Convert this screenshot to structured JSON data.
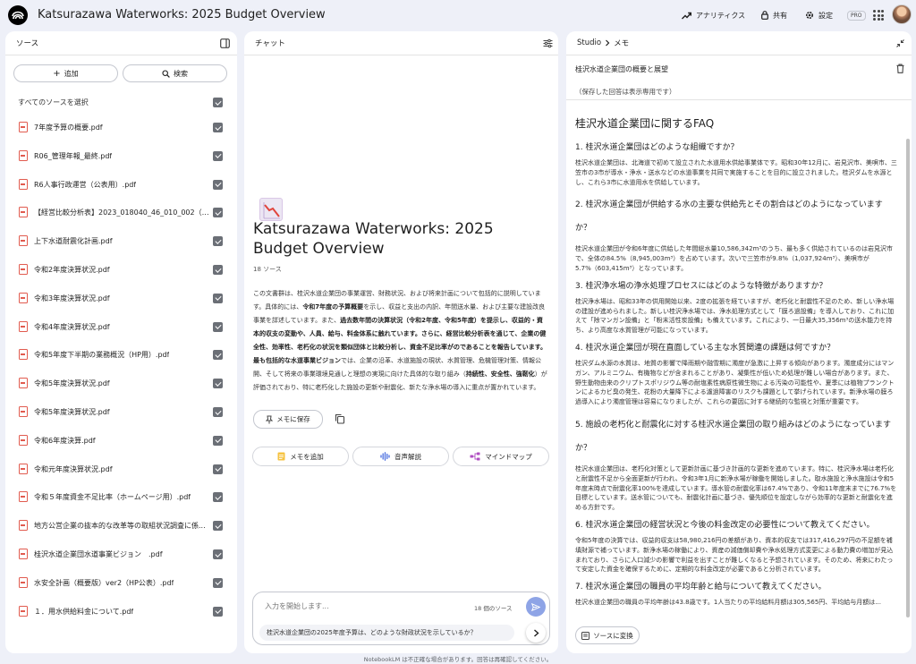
{
  "app": {
    "title": "Katsurazawa Waterworks: 2025 Budget Overview",
    "analytics_label": "アナリティクス",
    "share_label": "共有",
    "settings_label": "設定",
    "pro_badge": "PRO"
  },
  "sources": {
    "header": "ソース",
    "add_label": "追加",
    "search_label": "検索",
    "select_all_label": "すべてのソースを選択",
    "items": [
      "7年度予算の概要.pdf",
      "R06_管理年報_最終.pdf",
      "R6人事行政運営（公表用）.pdf",
      "【経営比較分析表】2023_018040_46_010_002（桂...",
      "上下水道耐震化計画.pdf",
      "令和2年度決算状況.pdf",
      "令和3年度決算状況.pdf",
      "令和4年度決算状況.pdf",
      "令和5年度下半期の業務概況（HP用）.pdf",
      "令和5年度決算状況.pdf",
      "令和5年度決算状況.pdf",
      "令和6年度決算.pdf",
      "令和元年度決算状況.pdf",
      "令和５年度資金不足比率（ホームページ用）.pdf",
      "地方公営企業の抜本的な改革等の取組状況調査に係...",
      "桂沢水道企業団水道事業ビジョン　.pdf",
      "水安全計画（概要版）ver2（HP公表）.pdf",
      "１．用水供給料金について.pdf"
    ]
  },
  "chat": {
    "header": "チャット",
    "notebook_title": "Katsurazawa Waterworks: 2025 Budget Overview",
    "source_count": "18 ソース",
    "summary_parts": [
      {
        "t": "この文書群は、桂沢水道企業団の事業運営、財務状況、および将来計画について包括的に説明しています。具体的には、",
        "b": false
      },
      {
        "t": "令和7年度の予算概要",
        "b": true
      },
      {
        "t": "を示し、収益と支出の内訳、年間送水量、および主要な建設改良事業を詳述しています。また、",
        "b": false
      },
      {
        "t": "過去数年間の決算状況（令和2年度、令和5年度）を提示し、収益的・資本的収支の変動や、人員、給与、料金体系に触れています。さらに、経営比較分析表を通じて、企業の健全性、効率性、老朽化の状況を類似団体と比較分析し、資金不足比率がのであることを報告しています。最も包括的な水道事業ビジョン",
        "b": true
      },
      {
        "t": "では、企業の沿革、水道施設の現状、水質管理、危機管理対策、情報公開、そして将来の事業環境見通しと理想の実現に向けた具体的な取り組み（",
        "b": false
      },
      {
        "t": "持続性、安全性、強靭化",
        "b": true
      },
      {
        "t": "）が評価されており、特に老朽化した施設の更新や耐震化、新たな浄水場の導入に重点が置かれています。",
        "b": false
      }
    ],
    "save_memo_label": "メモに保存",
    "add_memo_label": "メモを追加",
    "audio_label": "音声解説",
    "mindmap_label": "マインドマップ",
    "input_placeholder": "入力を開始します...",
    "input_source_count": "18 個のソース",
    "suggestion": "桂沢水道企業団の2025年度予算は、どのような財政状況を示しているか？"
  },
  "studio": {
    "breadcrumb_root": "Studio",
    "breadcrumb_current": "メモ",
    "memo_title": "桂沢水道企業団の概要と展望",
    "readonly_note": "（保存した回答は表示専用です）",
    "faq_heading": "桂沢水道企業団に関するFAQ",
    "faq": [
      {
        "q": "1. 桂沢水道企業団はどのような組織ですか？",
        "a": "桂沢水道企業団は、北海道で初めて設立された水道用水供給事業体です。昭和30年12月に、岩見沢市、美唄市、三笠市の3市が導水・浄水・送水などの水道事業を共同で実施することを目的に設立されました。桂沢ダムを水源とし、これら3市に水道用水を供給しています。"
      },
      {
        "q": "2. 桂沢水道企業団が供給する水の主要な供給先とその割合はどのようになっていますか？",
        "a": "桂沢水道企業団が令和6年度に供給した年間総水量10,586,342m³のうち、最も多く供給されているのは岩見沢市で、全体の84.5%（8,945,003m³）を占めています。次いで三笠市が9.8%（1,037,924m³）、美唄市が5.7%（603,415m³）となっています。"
      },
      {
        "q": "3. 桂沢浄水場の浄水処理プロセスにはどのような特徴がありますか？",
        "a": "桂沢浄水場は、昭和33年の供用開始以来、2度の拡張を経ていますが、老朽化と耐震性不足のため、新しい浄水場の建設が進められました。新しい桂沢浄水場では、浄水処理方式として「膜ろ過設備」を導入しており、これに加えて「除マンガン設備」と「粉末活性炭設備」も備えています。これにより、一日最大35,356m³の送水能力を持ち、より高度な水質管理が可能になっています。"
      },
      {
        "q": "4. 桂沢水道企業団が現在直面している主な水質関連の課題は何ですか？",
        "a": "桂沢ダム水源の水質は、地質の影響で降雨期や融雪期に濁度が急激に上昇する傾向があります。濁度成分にはマンガン、アルミニウム、有機物などが含まれることがあり、凝集性が低いため処理が難しい場合があります。また、野生動物由来のクリプトスポリジウム等の耐塩素性病原性微生物による汚染の可能性や、夏季には植物プランクトンによるカビ臭の発生、花粉の大量降下による濾過障害のリスクも課題として挙げられています。新浄水場の膜ろ過導入により濁度管理は容易になりましたが、これらの要因に対する継続的な監視と対策が重要です。"
      },
      {
        "q": "5. 施設の老朽化と耐震化に対する桂沢水道企業団の取り組みはどのようになっていますか？",
        "a": "桂沢水道企業団は、老朽化対策として更新計画に基づき計画的な更新を進めています。特に、桂沢浄水場は老朽化と耐震性不足から全面更新が行われ、令和3年1月に新浄水場が稼働を開始しました。取水施設と浄水施設は令和5年度末時点で耐震化率100%を達成しています。導水管の耐震化率は67.4%であり、令和11年度末までに76.7%を目標としています。送水管についても、耐震化計画に基づき、優先順位を設定しながら効率的な更新と耐震化を進める方針です。"
      },
      {
        "q": "6. 桂沢水道企業団の経営状況と今後の料金改定の必要性について教えてください。",
        "a": "令和5年度の決算では、収益的収支は58,980,216円の差額があり、資本的収支では317,416,297円の不足額を補填財源で補っています。新浄水場の稼働により、資産の減価償却費や浄水処理方式変更による動力費の増加が見込まれており、さらに人口減少の影響で利益を出すことが難しくなると予想されています。そのため、将来にわたって安定した資金を確保するために、定期的な料金改定が必要であると分析されています。"
      },
      {
        "q": "7. 桂沢水道企業団の職員の平均年齢と給与について教えてください。",
        "a": "桂沢水道企業団の職員の平均年齢は43.8歳です。1人当たりの平均給料月額は305,565円、平均給与月額は..."
      }
    ],
    "convert_label": "ソースに変換"
  },
  "footer": {
    "disclaimer": "NotebookLM は不正確な場合があります。回答は再確認してください。"
  }
}
